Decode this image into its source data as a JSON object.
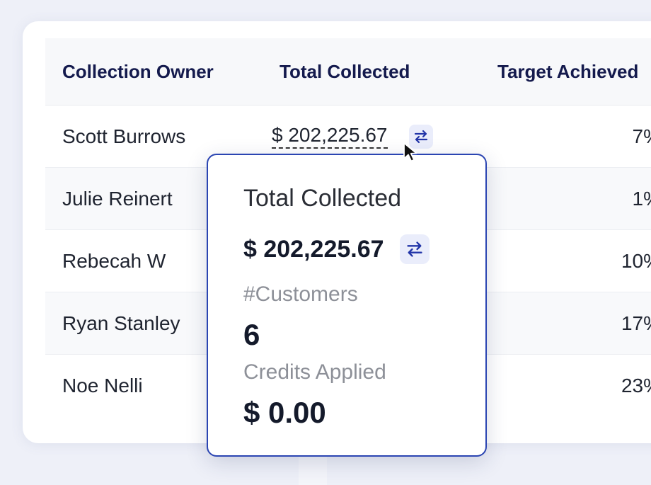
{
  "table": {
    "headers": {
      "owner": "Collection Owner",
      "total": "Total Collected",
      "target": "Target Achieved"
    },
    "rows": [
      {
        "owner": "Scott Burrows",
        "total": "$ 202,225.67",
        "target": "7%"
      },
      {
        "owner": "Julie Reinert",
        "target": "1%"
      },
      {
        "owner": "Rebecah W",
        "target": "10%"
      },
      {
        "owner": "Ryan Stanley",
        "target": "17%"
      },
      {
        "owner": "Noe Nelli",
        "target": "23%"
      }
    ],
    "swap_icon": "swap-arrows-icon"
  },
  "popover": {
    "title": "Total Collected",
    "amount": "$ 202,225.67",
    "customers_label": "#Customers",
    "customers_value": "6",
    "credits_label": "Credits Applied",
    "credits_value": "$ 0.00",
    "swap_icon": "swap-arrows-icon"
  },
  "colors": {
    "header_text": "#141a4d",
    "popover_border": "#2b45b2",
    "icon_accent": "#2235a8",
    "icon_bg": "#eaedfb"
  }
}
